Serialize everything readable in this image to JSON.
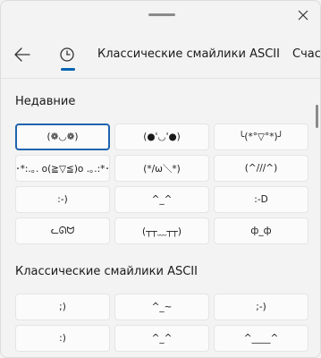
{
  "header": {
    "tab_ascii_label": "Классические смайлики ASCII",
    "tab_more_label": "Счас"
  },
  "recent": {
    "title": "Недавние",
    "items": [
      "(❁◡❁)",
      "(●'◡'●)",
      "╰(*°▽°*)╯",
      "･*:.｡. o(≧▽≦)o .｡.:*･",
      "(*/ω＼*)",
      "(^///^)",
      ":-)",
      "^_^",
      ":-D",
      "ᓚᘏᗢ",
      "(┬┬﹏┬┬)",
      "ф_ф"
    ]
  },
  "ascii": {
    "title": "Классические смайлики ASCII",
    "items": [
      ";)",
      "^_~",
      ";-)",
      ":)",
      "^_^",
      "^____^"
    ]
  },
  "colors": {
    "accent": "#0063b1",
    "background": "#f3f3f3",
    "cell": "#fbfbfb"
  }
}
